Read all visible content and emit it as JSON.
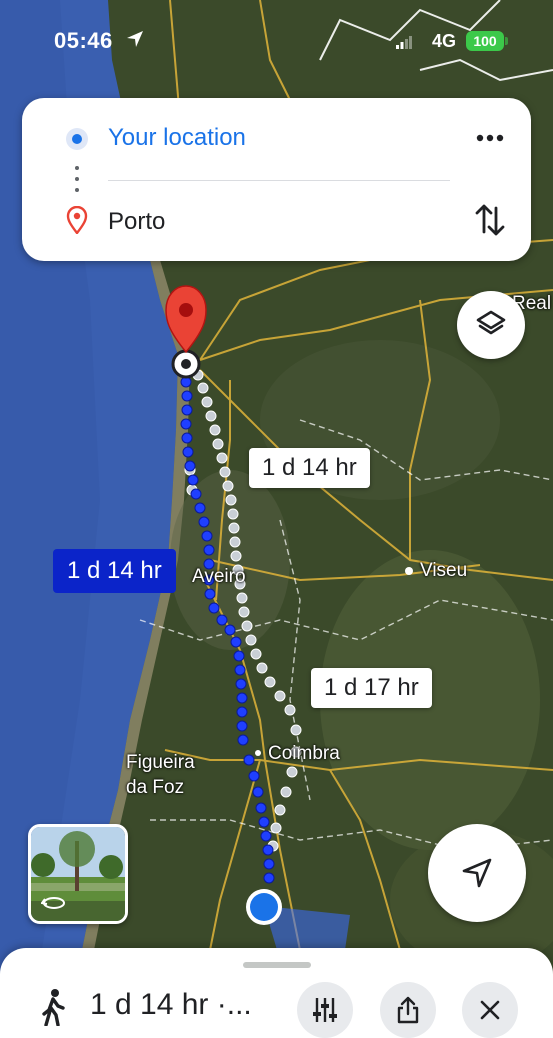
{
  "status_bar": {
    "time": "05:46",
    "network": "4G",
    "battery": "100"
  },
  "directions": {
    "origin": "Your location",
    "destination": "Porto"
  },
  "map": {
    "labels": {
      "aveiro": "Aveiro",
      "viseu": "Viseu",
      "coimbra": "Coimbra",
      "figueira_line1": "Figueira",
      "figueira_line2": "da Foz",
      "real": "Real"
    },
    "route_times": {
      "selected": "1 d 14 hr",
      "alt1": "1 d 14 hr",
      "alt2": "1 d 17 hr"
    }
  },
  "bottom_sheet": {
    "summary": "1 d 14 hr ·..."
  },
  "icons": {
    "location": "location-arrow-icon",
    "more": "more-horizontal-icon",
    "swap": "swap-vertical-icon",
    "layers": "layers-icon",
    "recenter": "navigation-arrow-icon",
    "walk": "walking-person-icon",
    "options": "sliders-icon",
    "share": "share-icon",
    "close": "close-icon"
  },
  "colors": {
    "accent": "#1a73e8",
    "route": "#1f3fff",
    "selected_eta": "#0b24c9",
    "pin": "#ea4335",
    "battery": "#3cc94a"
  }
}
